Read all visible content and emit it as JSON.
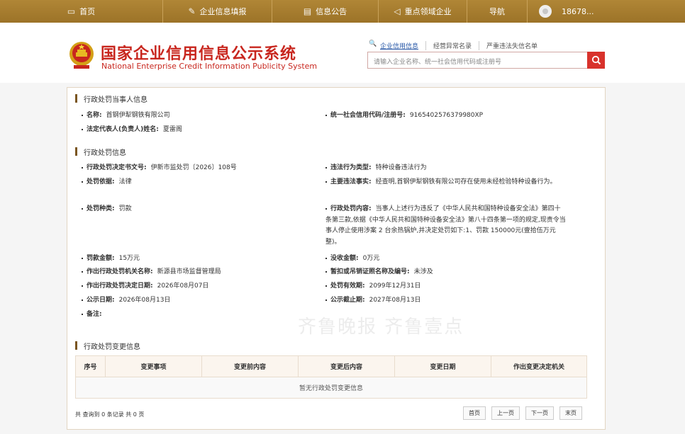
{
  "nav": {
    "home": "首页",
    "fill": "企业信息填报",
    "notice": "信息公告",
    "key": "重点领域企业",
    "guide": "导航",
    "user": "18678..."
  },
  "header": {
    "title": "国家企业信用信息公示系统",
    "subtitle": "National Enterprise Credit Information Publicity System",
    "tabs": [
      "企业信用信息",
      "经营异常名录",
      "严重违法失信名单"
    ],
    "search_placeholder": "请输入企业名称、统一社会信用代码或注册号"
  },
  "party": {
    "title": "行政处罚当事人信息",
    "name_label": "名称:",
    "name": "首钢伊犁钢铁有限公司",
    "code_label": "统一社会信用代码/注册号:",
    "code": "9165402576379980XP",
    "rep_label": "法定代表人(负责人)姓名:",
    "rep": "夏雷阁"
  },
  "penalty": {
    "title": "行政处罚信息",
    "doc_label": "行政处罚决定书文号:",
    "doc": "伊新市监处罚〔2026〕108号",
    "type_label": "违法行为类型:",
    "type": "特种设备违法行为",
    "basis_label": "处罚依据:",
    "basis": "法律",
    "fact_label": "主要违法事实:",
    "fact": "经查明,首钢伊犁钢铁有限公司存在使用未经检验特种设备行为。",
    "kind_label": "处罚种类:",
    "kind": "罚款",
    "content_label": "行政处罚内容:",
    "content": "当事人上述行为违反了《中华人民共和国特种设备安全法》第四十条第三款,依据《中华人民共和国特种设备安全法》第八十四条第一项的规定,现责令当事人停止使用涉案 2 台余热锅炉,并决定处罚如下:1、罚款 150000元(壹拾伍万元整)。",
    "fine_label": "罚款金额:",
    "fine": "15万元",
    "confiscate_label": "没收金额:",
    "confiscate": "0万元",
    "authority_label": "作出行政处罚机关名称:",
    "authority": "新源县市场监督管理局",
    "license_label": "暂扣或吊销证照名称及编号:",
    "license": "未涉及",
    "date_label": "作出行政处罚决定日期:",
    "date": "2026年08月07日",
    "valid_label": "处罚有效期:",
    "valid": "2099年12月31日",
    "pub_label": "公示日期:",
    "pub": "2026年08月13日",
    "end_label": "公示截止期:",
    "end": "2027年08月13日",
    "remark_label": "备注:"
  },
  "changes": {
    "title": "行政处罚变更信息",
    "headers": [
      "序号",
      "变更事项",
      "变更前内容",
      "变更后内容",
      "变更日期",
      "作出变更决定机关"
    ],
    "empty": "暂无行政处罚变更信息",
    "summary": "共 查询到 0 条记录 共 0 页",
    "pager": [
      "首页",
      "上一页",
      "下一页",
      "末页"
    ]
  },
  "watermark": "齐鲁晚报 齐鲁壹点"
}
